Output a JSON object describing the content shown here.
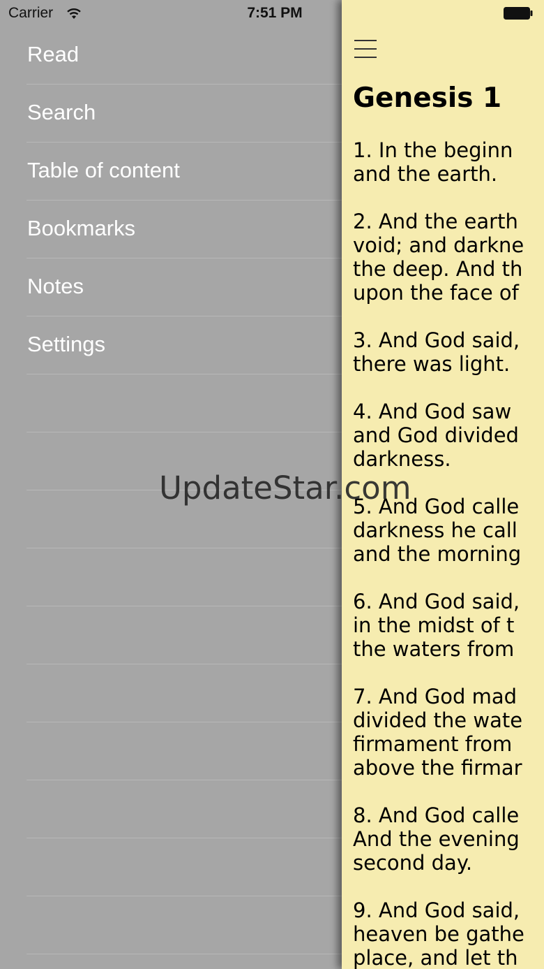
{
  "status_bar": {
    "carrier": "Carrier",
    "time": "7:51 PM"
  },
  "menu": {
    "items": [
      {
        "label": "Read"
      },
      {
        "label": "Search"
      },
      {
        "label": "Table of content"
      },
      {
        "label": "Bookmarks"
      },
      {
        "label": "Notes"
      },
      {
        "label": "Settings"
      }
    ]
  },
  "reader": {
    "chapter_title": "Genesis 1",
    "verses": [
      "1. In the beginn\nand the earth.",
      "2. And the earth\nvoid; and darkne\nthe deep. And th\nupon the face of",
      "3. And God said,\nthere was light.",
      "4. And God saw\nand God divided\ndarkness.",
      "5. And God calle\ndarkness he call\nand the morning",
      "6. And God said,\nin the midst of t\nthe waters from",
      "7. And God mad\ndivided the wate\nfirmament from\nabove the firmar",
      "8. And God calle\nAnd the evening\nsecond day.",
      "9. And God said,\nheaven be gathe\nplace, and let th"
    ]
  },
  "watermark": "UpdateStar.com"
}
